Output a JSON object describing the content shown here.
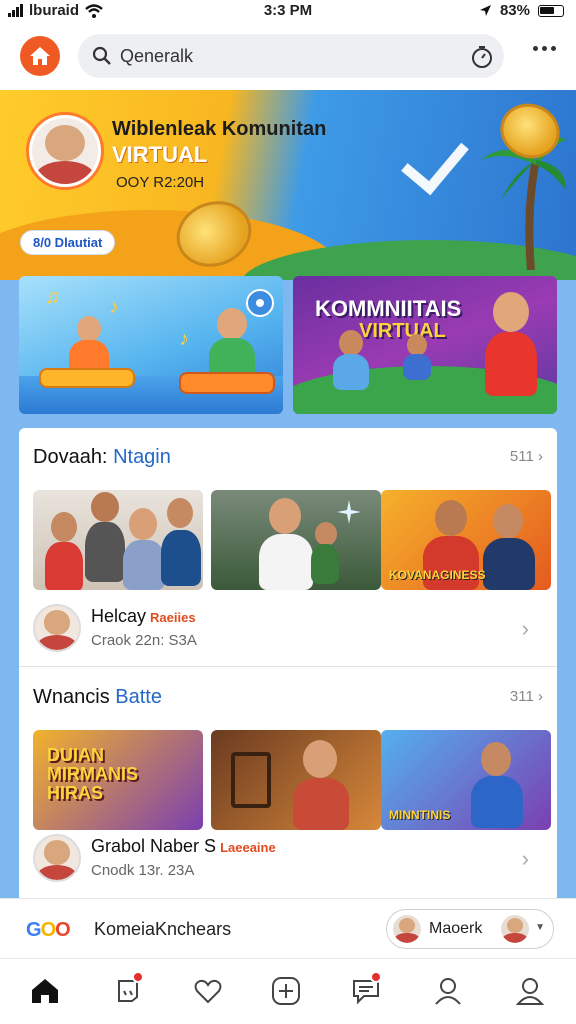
{
  "status_bar": {
    "carrier": "lburaid",
    "time": "3:3 PM",
    "battery": "83%"
  },
  "header": {
    "search_placeholder": "Qeneralk",
    "icons": [
      "home-logo-icon",
      "search-icon",
      "timer-icon",
      "more-icon"
    ]
  },
  "hero": {
    "title": "Wiblenleak Komunitan",
    "subtitle": "VIRTUAL",
    "date": "OOY R2:20H",
    "badge": "8/0 Dlautiat"
  },
  "cards": [
    {
      "title": "",
      "subtitle": ""
    },
    {
      "title": "KOMMNIITAIS",
      "subtitle": "VIRTUAL"
    }
  ],
  "section1": {
    "title": "Dovaah:",
    "title_accent": "Ntagin",
    "count": "511",
    "thumbs": [
      {
        "caption": ""
      },
      {
        "caption": ""
      },
      {
        "caption": "KOVANAGINESS"
      }
    ],
    "row": {
      "name": "Helcay",
      "tag": "Raeiies",
      "meta": "Craok  22n:  S3A"
    }
  },
  "section2": {
    "title": "Wnancis",
    "title_accent": "Batte",
    "count": "311",
    "thumbs": [
      {
        "caption": "DUIAN MIRMANIS HIRAS"
      },
      {
        "caption": ""
      },
      {
        "caption": "MINNTINIS"
      }
    ],
    "row": {
      "name": "Grabol Naber S",
      "tag": "Laeeaine",
      "meta": "Cnodk  13r.  23A"
    }
  },
  "footer": {
    "logo": [
      "G",
      "O",
      "O"
    ],
    "label": "KomeiaKnchears",
    "pill_label": "Maoerk"
  },
  "tabbar": {
    "tabs": [
      "home-icon",
      "notification-icon",
      "heart-icon",
      "add-icon",
      "chat-icon",
      "profile-icon",
      "account-icon"
    ]
  },
  "colors": {
    "accent": "#2468c8",
    "brand": "#ef5a24",
    "badge": "#e53030"
  }
}
